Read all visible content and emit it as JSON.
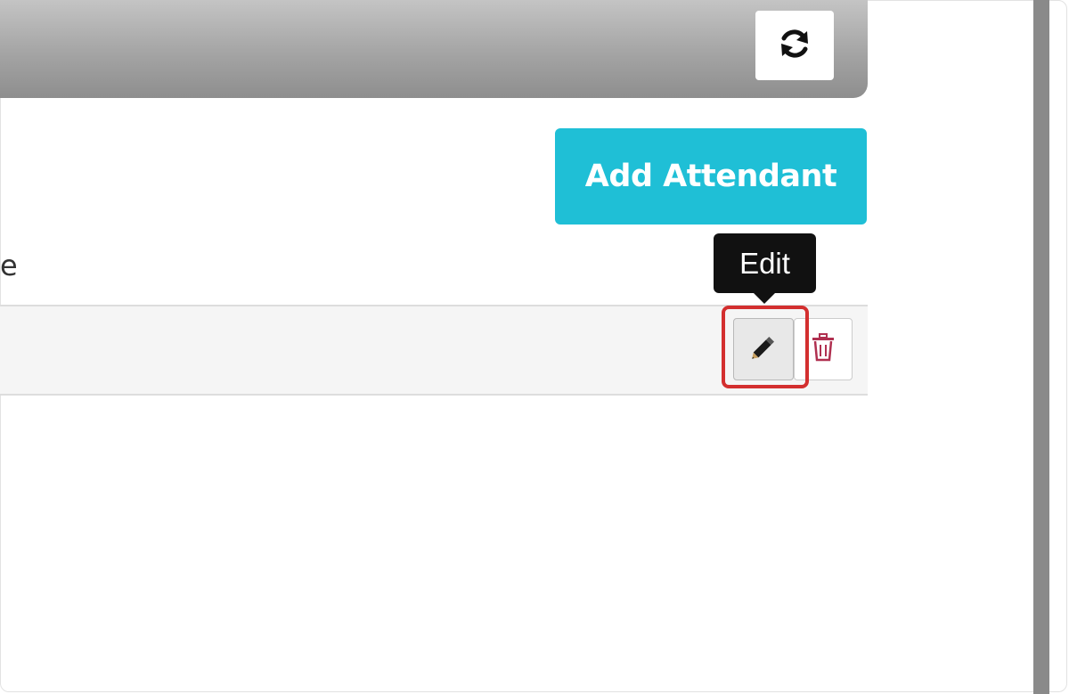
{
  "header": {
    "refresh_icon": "refresh-icon"
  },
  "toolbar": {
    "add_label": "Add Attendant"
  },
  "table": {
    "partial_column_header": "e",
    "rows": [
      {
        "partial_cell": ")"
      }
    ]
  },
  "row_actions": {
    "edit_icon": "pencil-icon",
    "delete_icon": "trash-icon",
    "tooltip": "Edit"
  },
  "colors": {
    "accent": "#1fbfd6",
    "highlight": "#d32f2f",
    "delete": "#b03050"
  }
}
